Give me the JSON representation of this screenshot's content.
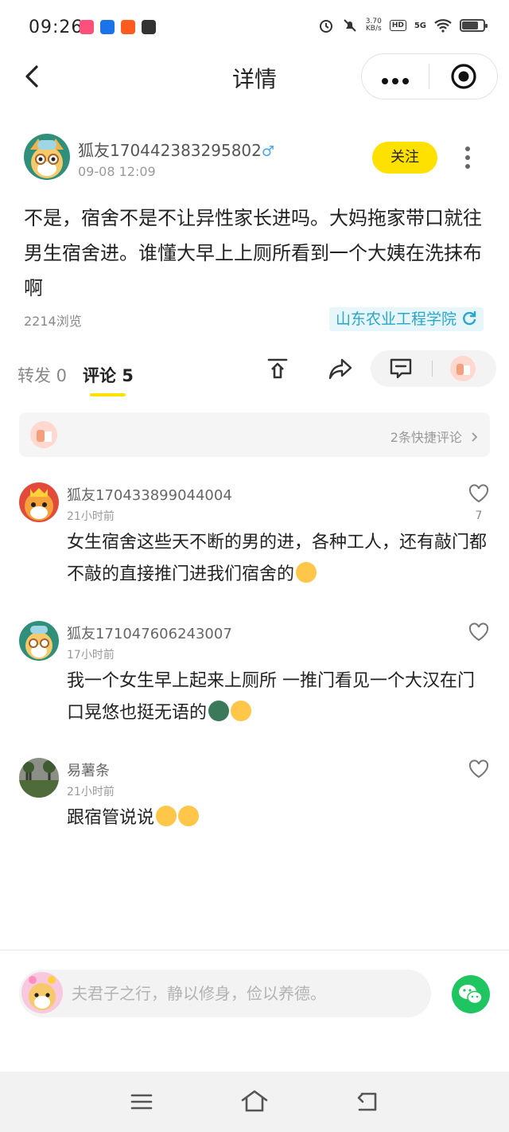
{
  "status_bar": {
    "time": "09:26",
    "net_speed_value": "3.70",
    "net_speed_unit": "KB/s",
    "hd": "HD",
    "signal": "5G",
    "battery_level": 0.75
  },
  "nav": {
    "title": "详情",
    "more_label": "•••"
  },
  "post": {
    "username": "狐友170442383295802",
    "gender_symbol": "♂",
    "time": "09-08 12:09",
    "follow_label": "关注",
    "content": "不是，宿舍不是不让异性家长进吗。大妈拖家带口就往男生宿舍进。谁懂大早上上厕所看到一个大姨在洗抹布啊",
    "views": "2214浏览",
    "school_tag": "山东农业工程学院"
  },
  "tabs": {
    "repost": "转发 0",
    "comments": "评论 5"
  },
  "quick_comments": {
    "label": "2条快捷评论"
  },
  "comments": [
    {
      "user": "狐友170433899044004",
      "time": "21小时前",
      "text": "女生宿舍这些天不断的男的进，各种工人，还有敲门都不敲的直接推门进我们宿舍的",
      "likes": "7"
    },
    {
      "user": "狐友171047606243007",
      "time": "17小时前",
      "text": "我一个女生早上起来上厕所 一推门看见一个大汉在门口晃悠也挺无语的"
    },
    {
      "user": "易薯条",
      "time": "21小时前",
      "text": "跟宿管说说"
    }
  ],
  "input": {
    "placeholder": "夫君子之行，静以修身，俭以养德。"
  },
  "colors": {
    "accent": "#ffe100",
    "tag_text": "#2aa6c8",
    "wechat": "#1ec560"
  }
}
